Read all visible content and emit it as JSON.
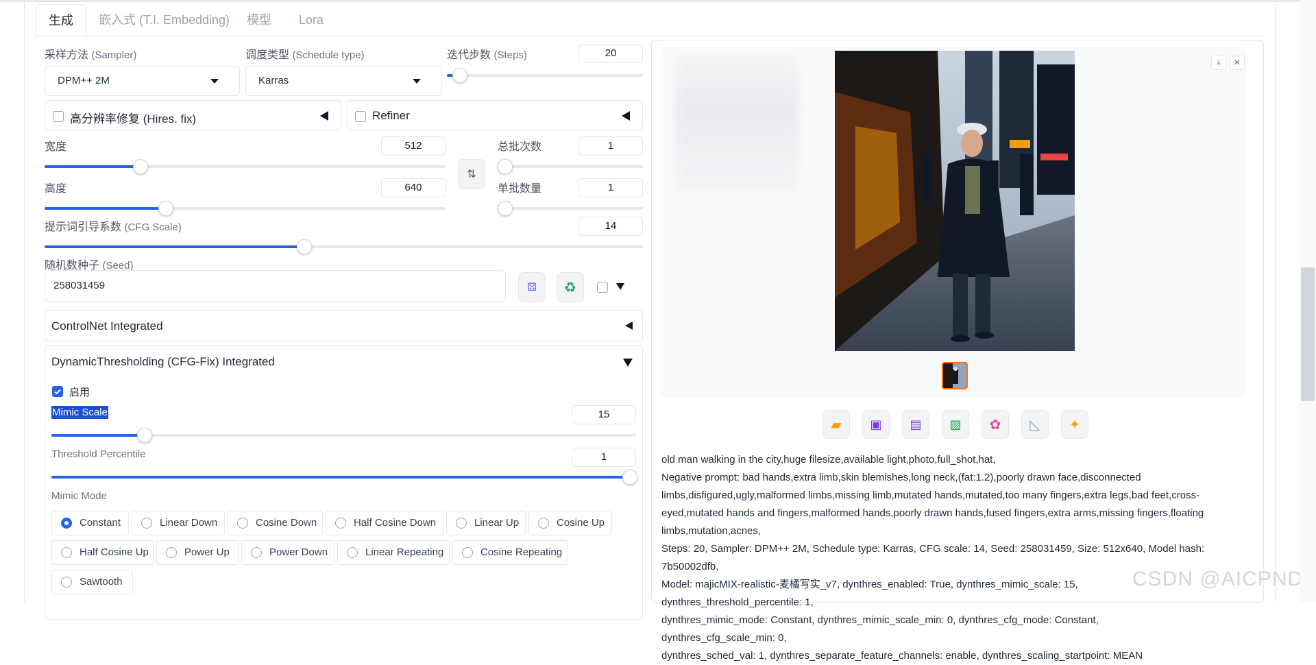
{
  "tabs": [
    "生成",
    "嵌入式 (T.I. Embedding)",
    "模型",
    "Lora"
  ],
  "sampler": {
    "label": "采样方法",
    "label_en": "(Sampler)",
    "value": "DPM++ 2M"
  },
  "schedule": {
    "label": "调度类型",
    "label_en": "(Schedule type)",
    "value": "Karras"
  },
  "steps": {
    "label": "迭代步数",
    "label_en": "(Steps)",
    "value": "20",
    "fraction": 0.063
  },
  "hires": {
    "label": "高分辨率修复",
    "label_en": "(Hires. fix)"
  },
  "refiner": {
    "label": "Refiner"
  },
  "width": {
    "label": "宽度",
    "value": "512",
    "fraction": 0.238
  },
  "height": {
    "label": "高度",
    "value": "640",
    "fraction": 0.3
  },
  "batch_count": {
    "label": "总批次数",
    "value": "1",
    "fraction": 0.0
  },
  "batch_size": {
    "label": "单批数量",
    "value": "1",
    "fraction": 0.0
  },
  "cfg": {
    "label": "提示词引导系数",
    "label_en": "(CFG Scale)",
    "value": "14",
    "fraction": 0.4333
  },
  "seed": {
    "label": "随机数种子",
    "label_en": "(Seed)",
    "value": "258031459"
  },
  "controlnet": {
    "title": "ControlNet Integrated"
  },
  "dynthres": {
    "title": "DynamicThresholding (CFG-Fix) Integrated",
    "enable_label": "启用",
    "mimic_scale": {
      "label": "Mimic Scale",
      "value": "15",
      "fraction": 0.1578
    },
    "threshold": {
      "label": "Threshold Percentile",
      "value": "1",
      "fraction": 1.0
    },
    "mimic_mode": {
      "label": "Mimic Mode",
      "selected": "Constant",
      "options": [
        "Constant",
        "Linear Down",
        "Cosine Down",
        "Half Cosine Down",
        "Linear Up",
        "Cosine Up",
        "Half Cosine Up",
        "Power Up",
        "Power Down",
        "Linear Repeating",
        "Cosine Repeating",
        "Sawtooth"
      ]
    }
  },
  "toolbar_icons": [
    "folder-icon",
    "save-icon",
    "zip-icon",
    "image-icon",
    "palette-icon",
    "ruler-icon",
    "sparkle-icon"
  ],
  "info_lines": [
    "old man walking in the city,huge filesize,available light,photo,full_shot,hat,",
    "Negative prompt: bad hands,extra limb,skin blemishes,long neck,(fat:1.2),poorly drawn face,disconnected",
    "limbs,disfigured,ugly,malformed limbs,missing limb,mutated hands,mutated,too many fingers,extra legs,bad feet,cross-",
    "eyed,mutated hands and fingers,malformed hands,poorly drawn hands,fused fingers,extra arms,missing fingers,floating",
    "limbs,mutation,acnes,",
    "Steps: 20, Sampler: DPM++ 2M, Schedule type: Karras, CFG scale: 14, Seed: 258031459, Size: 512x640, Model hash: 7b50002dfb,",
    "Model: majicMIX-realistic-麦橘写实_v7, dynthres_enabled: True, dynthres_mimic_scale: 15, dynthres_threshold_percentile: 1,",
    "dynthres_mimic_mode: Constant, dynthres_mimic_scale_min: 0, dynthres_cfg_mode: Constant, dynthres_cfg_scale_min: 0,",
    "dynthres_sched_val: 1, dynthres_separate_feature_channels: enable, dynthres_scaling_startpoint: MEAN"
  ],
  "watermark": "CSDN @AICPND"
}
